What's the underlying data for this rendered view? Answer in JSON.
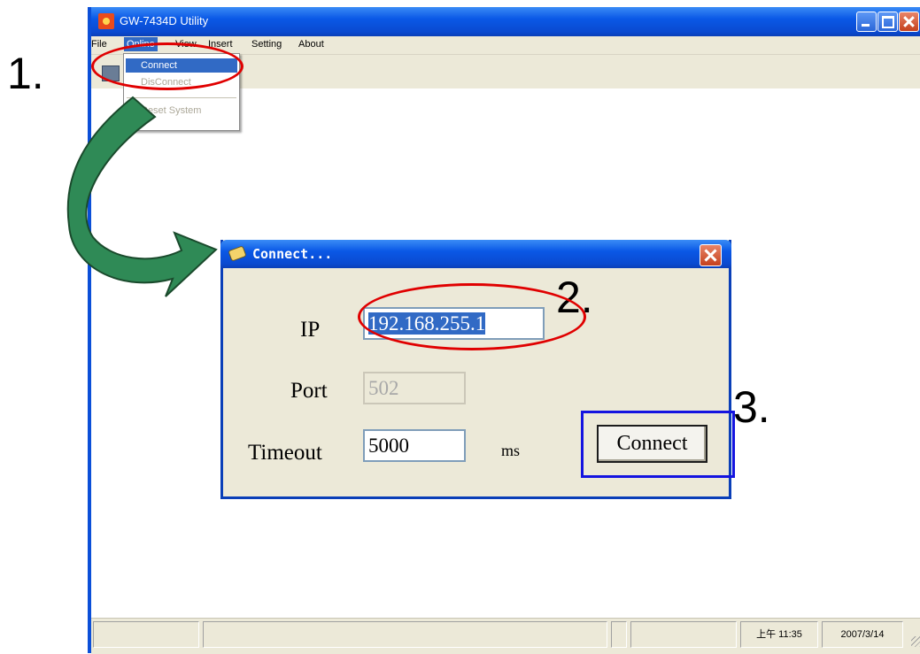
{
  "window": {
    "title": "GW-7434D Utility",
    "menu": [
      "File",
      "Online",
      "View",
      "Insert",
      "Setting",
      "About"
    ],
    "online_menu": {
      "items": [
        {
          "label": "Connect",
          "state": "highlighted"
        },
        {
          "label": "DisConnect",
          "state": "disabled"
        },
        {
          "label": "Reset System",
          "state": "disabled"
        }
      ]
    },
    "status_bar": {
      "time": "上午 11:35",
      "date": "2007/3/14"
    }
  },
  "dialog": {
    "title": "Connect...",
    "ip_label": "IP",
    "ip_value": "192.168.255.1",
    "port_label": "Port",
    "port_value": "502",
    "timeout_label": "Timeout",
    "timeout_value": "5000",
    "timeout_unit": "ms",
    "connect_button": "Connect"
  },
  "annotations": {
    "step1": "1.",
    "step2": "2.",
    "step3": "3.",
    "ring_color": "#e00000",
    "box_color": "#1414e0",
    "arrow_color": "#2f8a56"
  }
}
